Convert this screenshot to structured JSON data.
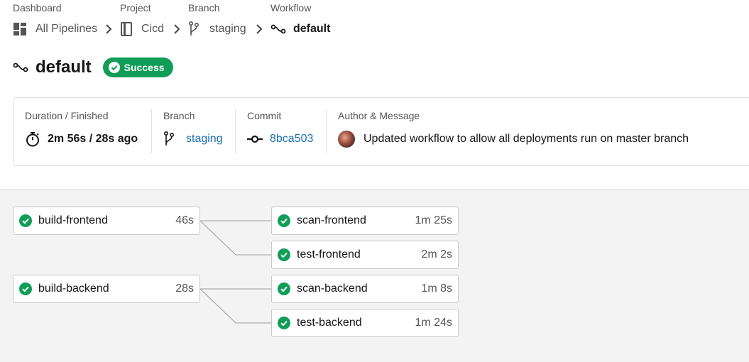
{
  "breadcrumb": {
    "dashboard": {
      "heading": "Dashboard",
      "label": "All Pipelines"
    },
    "project": {
      "heading": "Project",
      "label": "Cicd"
    },
    "branch": {
      "heading": "Branch",
      "label": "staging"
    },
    "workflow": {
      "heading": "Workflow",
      "label": "default"
    }
  },
  "header": {
    "title": "default",
    "status": "Success"
  },
  "info": {
    "duration": {
      "label": "Duration / Finished",
      "value": "2m 56s / 28s ago"
    },
    "branch": {
      "label": "Branch",
      "value": "staging"
    },
    "commit": {
      "label": "Commit",
      "value": "8bca503"
    },
    "author": {
      "label": "Author & Message",
      "message": "Updated workflow to allow all deployments run on master branch"
    }
  },
  "jobs": {
    "build_frontend": {
      "name": "build-frontend",
      "duration": "46s",
      "status": "success"
    },
    "scan_frontend": {
      "name": "scan-frontend",
      "duration": "1m 25s",
      "status": "success"
    },
    "test_frontend": {
      "name": "test-frontend",
      "duration": "2m 2s",
      "status": "success"
    },
    "build_backend": {
      "name": "build-backend",
      "duration": "28s",
      "status": "success"
    },
    "scan_backend": {
      "name": "scan-backend",
      "duration": "1m 8s",
      "status": "success"
    },
    "test_backend": {
      "name": "test-backend",
      "duration": "1m 24s",
      "status": "success"
    }
  },
  "colors": {
    "success": "#0f9d58",
    "link": "#1a6fb8",
    "muted": "#555555",
    "text": "#161616"
  },
  "icons": {
    "dashboard": "dashboard-icon",
    "project": "project-book-icon",
    "branch": "git-branch-icon",
    "workflow": "workflow-icon",
    "chevron": "chevron-right-icon",
    "check": "check-circle-icon",
    "timer": "stopwatch-icon",
    "commit": "git-commit-icon",
    "avatar": "user-avatar"
  }
}
